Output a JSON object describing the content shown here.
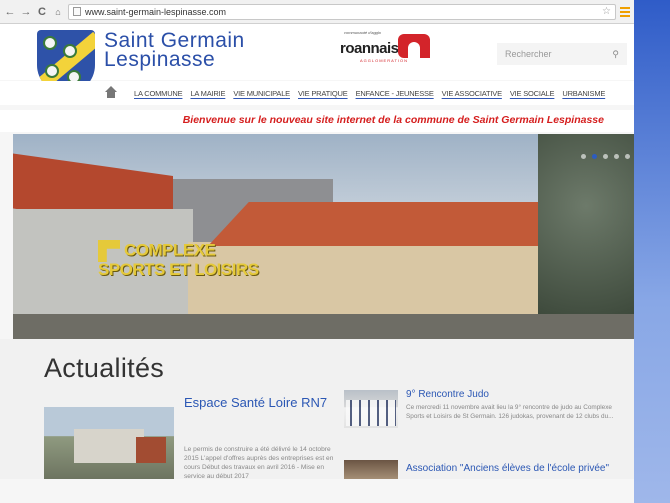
{
  "browser": {
    "back": "←",
    "forward": "→",
    "reload": "C",
    "home": "🏠",
    "url": "www.saint-germain-lespinasse.com",
    "star": "☆"
  },
  "header": {
    "site_title_line1": "Saint Germain",
    "site_title_line2": "Lespinasse",
    "partner_small": "communauté d'agglo",
    "partner_word": "roannais",
    "partner_sub": "AGGLOMERATION",
    "search_placeholder": "Rechercher",
    "search_icon": "🔍"
  },
  "nav": {
    "items": [
      "LA COMMUNE",
      "LA MAIRIE",
      "VIE MUNICIPALE",
      "VIE PRATIQUE",
      "ENFANCE - JEUNESSE",
      "VIE ASSOCIATIVE",
      "VIE SOCIALE",
      "URBANISME"
    ]
  },
  "welcome": "Bienvenue sur le nouveau site internet de la commune de Saint Germain Lespinasse",
  "hero": {
    "sign_line1": "COMPLEXE",
    "sign_line2": "SPORTS ET LOISIRS",
    "slide_count": 5,
    "active_slide": 2
  },
  "news": {
    "title": "Actualités",
    "items": [
      {
        "title": "Espace Santé Loire RN7",
        "text": "Le permis de construire a été délivré le 14 octobre 2015 L'appel d'offres auprès des entreprises est en cours Début des travaux en avril 2016 - Mise en service au début 2017"
      },
      {
        "title": "9° Rencontre Judo",
        "text": "Ce mercredi 11 novembre avait lieu la 9° rencontre de judo au Complexe Sports et Loisirs de St Germain. 126 judokas, provenant de 12 clubs du..."
      },
      {
        "title": "Association \"Anciens élèves de l'école privée\"",
        "text": ""
      }
    ]
  },
  "colors": {
    "brand_blue": "#2b4fa8",
    "welcome_red": "#d51e1e",
    "link_blue": "#2b57b4"
  }
}
